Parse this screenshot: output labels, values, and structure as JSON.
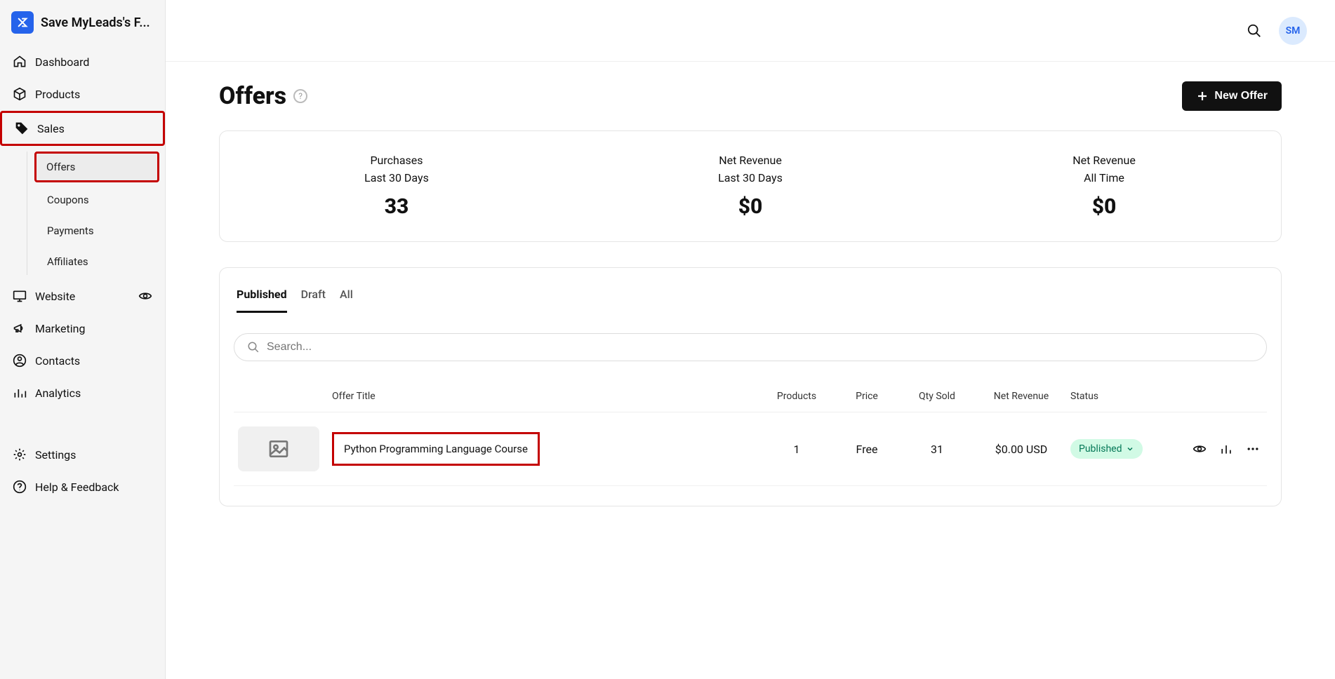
{
  "app": {
    "title": "Save MyLeads's F...",
    "avatar": "SM"
  },
  "sidebar": {
    "items": {
      "dashboard": "Dashboard",
      "products": "Products",
      "sales": "Sales",
      "website": "Website",
      "marketing": "Marketing",
      "contacts": "Contacts",
      "analytics": "Analytics",
      "settings": "Settings",
      "help": "Help & Feedback"
    },
    "salesSub": {
      "offers": "Offers",
      "coupons": "Coupons",
      "payments": "Payments",
      "affiliates": "Affiliates"
    }
  },
  "page": {
    "title": "Offers",
    "newButton": "New Offer",
    "searchPlaceholder": "Search..."
  },
  "stats": [
    {
      "label": "Purchases",
      "sub": "Last 30 Days",
      "value": "33"
    },
    {
      "label": "Net Revenue",
      "sub": "Last 30 Days",
      "value": "$0"
    },
    {
      "label": "Net Revenue",
      "sub": "All Time",
      "value": "$0"
    }
  ],
  "tabs": {
    "published": "Published",
    "draft": "Draft",
    "all": "All"
  },
  "columns": {
    "title": "Offer Title",
    "products": "Products",
    "price": "Price",
    "qty": "Qty Sold",
    "revenue": "Net Revenue",
    "status": "Status"
  },
  "rows": [
    {
      "title": "Python Programming Language Course",
      "products": "1",
      "price": "Free",
      "qty": "31",
      "revenue": "$0.00 USD",
      "status": "Published"
    }
  ]
}
